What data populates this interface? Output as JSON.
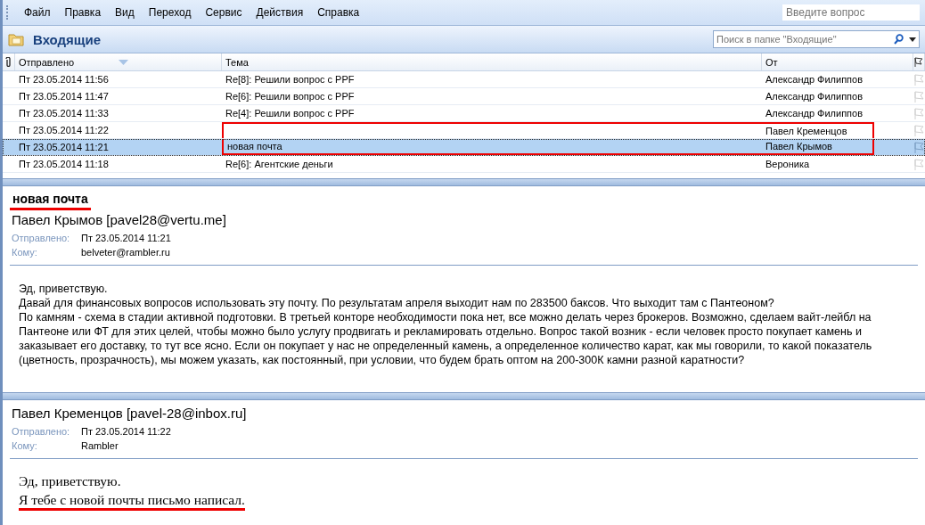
{
  "menu": [
    {
      "label": "Файл"
    },
    {
      "label": "Правка"
    },
    {
      "label": "Вид"
    },
    {
      "label": "Переход"
    },
    {
      "label": "Сервис"
    },
    {
      "label": "Действия"
    },
    {
      "label": "Справка"
    }
  ],
  "help_search": {
    "placeholder": "Введите вопрос"
  },
  "folder": {
    "title": "Входящие",
    "search": {
      "placeholder": "Поиск в папке \"Входящие\""
    }
  },
  "table": {
    "columns": [
      {
        "kind": "attach"
      },
      {
        "kind": "text",
        "label": "Отправлено",
        "sorted": true
      },
      {
        "kind": "text",
        "label": "Тема"
      },
      {
        "kind": "text",
        "label": "От"
      },
      {
        "kind": "flag"
      }
    ],
    "rows": [
      {
        "sent": "Пт 23.05.2014 11:56",
        "subject": "Re[8]: Решили вопрос с PPF",
        "from": "Александр  Филиппов",
        "selected": false,
        "highlighted": false
      },
      {
        "sent": "Пт 23.05.2014 11:47",
        "subject": "Re[6]: Решили вопрос с PPF",
        "from": "Александр  Филиппов",
        "selected": false,
        "highlighted": false
      },
      {
        "sent": "Пт 23.05.2014 11:33",
        "subject": "Re[4]: Решили вопрос с PPF",
        "from": "Александр  Филиппов",
        "selected": false,
        "highlighted": false
      },
      {
        "sent": "Пт 23.05.2014 11:22",
        "from": "Павел Кременцов",
        "selected": false,
        "highlighted": true
      },
      {
        "sent": "Пт 23.05.2014 11:21",
        "subject": "новая почта",
        "from": "Павел Крымов",
        "selected": true,
        "highlighted": true
      },
      {
        "sent": "Пт 23.05.2014 11:18",
        "subject": "Re[6]: Агентские деньги",
        "from": "Вероника",
        "selected": false,
        "highlighted": false
      }
    ]
  },
  "messages": [
    {
      "subject": "новая почта",
      "subject_underlined": true,
      "sender": "Павел Крымов [pavel28@vertu.me]",
      "sent_label": "Отправлено:",
      "sent": "Пт 23.05.2014 11:21",
      "to_label": "Кому:",
      "to": "belveter@rambler.ru",
      "kind": "plain",
      "body": [
        {
          "text": "Эд, приветствую.",
          "underlined": false
        },
        {
          "text": "Давай для финансовых вопросов использовать эту почту. По результатам апреля выходит нам по 283500 баксов. Что выходит там с Пантеоном?",
          "underlined": false
        },
        {
          "text": "По камням - схема в стадии активной подготовки. В третьей конторе необходимости пока нет, все можно делать через брокеров. Возможно, сделаем вайт-лейбл на Пантеоне или ФТ для этих целей, чтобы можно было услугу продвигать и рекламировать отдельно. Вопрос такой возник - если человек просто покупает камень и заказывает его доставку, то тут все ясно. Если он покупает у нас не определенный камень, а определенное количество карат, как мы говорили, то какой показатель (цветность, прозрачность), мы можем указать, как постоянный, при условии, что будем брать оптом на 200-300К камни разной каратности?",
          "underlined": false
        }
      ]
    },
    {
      "sender": "Павел Кременцов [pavel-28@inbox.ru]",
      "sent_label": "Отправлено:",
      "sent": "Пт 23.05.2014 11:22",
      "to_label": "Кому:",
      "to": "Rambler",
      "kind": "formatted",
      "body": [
        {
          "text": "Эд, приветствую.",
          "underlined": false
        },
        {
          "text": "Я тебе с новой почты письмо написал.",
          "underlined": true
        }
      ]
    }
  ]
}
